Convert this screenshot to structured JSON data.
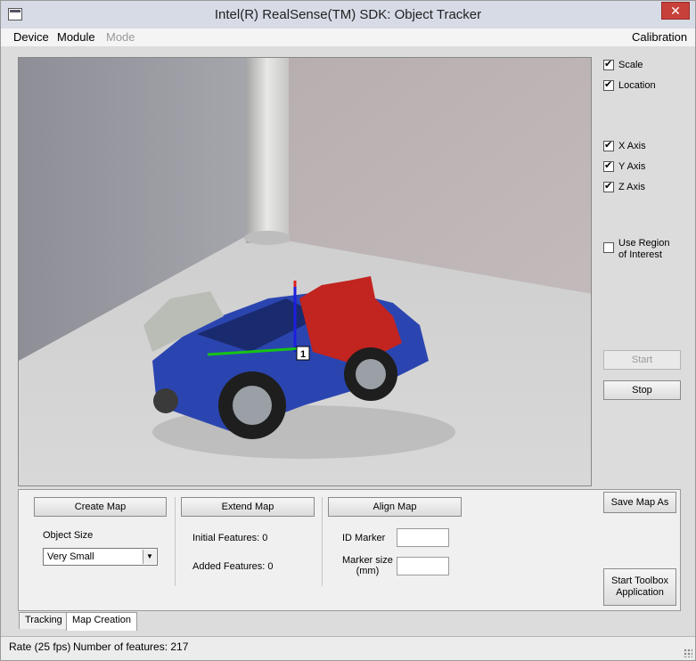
{
  "window": {
    "title": "Intel(R) RealSense(TM) SDK: Object Tracker",
    "close_glyph": "✕"
  },
  "menu": {
    "device": "Device",
    "module": "Module",
    "mode": "Mode",
    "calibration": "Calibration"
  },
  "camera": {
    "marker_label": "1"
  },
  "options": {
    "scale": {
      "label": "Scale",
      "checked": true
    },
    "location": {
      "label": "Location",
      "checked": true
    },
    "x_axis": {
      "label": "X Axis",
      "checked": true
    },
    "y_axis": {
      "label": "Y Axis",
      "checked": true
    },
    "z_axis": {
      "label": "Z Axis",
      "checked": true
    },
    "use_roi": {
      "label_line1": "Use Region",
      "label_line2": "of Interest",
      "checked": false
    }
  },
  "buttons": {
    "start": "Start",
    "stop": "Stop",
    "save_map_as": "Save Map As",
    "start_toolbox_line1": "Start Toolbox",
    "start_toolbox_line2": "Application",
    "create_map": "Create Map",
    "extend_map": "Extend Map",
    "align_map": "Align Map"
  },
  "map_creation": {
    "object_size_label": "Object Size",
    "object_size_value": "Very Small",
    "initial_features": "Initial Features: 0",
    "added_features": "Added Features: 0",
    "id_marker_label": "ID Marker",
    "id_marker_value": "",
    "marker_size_line1": "Marker size",
    "marker_size_line2": "(mm)",
    "marker_size_value": ""
  },
  "tabs": {
    "tracking": "Tracking",
    "map_creation": "Map Creation"
  },
  "status": {
    "rate": "Rate (25 fps)",
    "features": "Number of features: 217"
  },
  "icons": [
    "app-window-icon",
    "close-icon",
    "checkbox-icon",
    "dropdown-arrow-icon",
    "resize-grip-icon"
  ]
}
